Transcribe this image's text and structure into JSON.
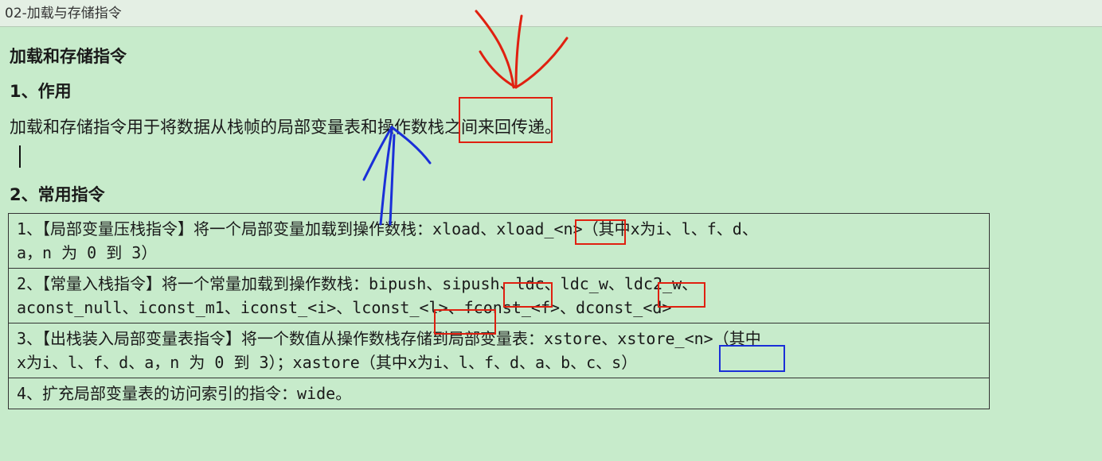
{
  "window": {
    "title": "02-加载与存储指令"
  },
  "doc": {
    "heading": "加载和存储指令",
    "section1_title": "1、作用",
    "section1_body": "加载和存储指令用于将数据从栈帧的局部变量表和操作数栈之间来回传递。",
    "section2_title": "2、常用指令",
    "rows": [
      {
        "line1": "1、【局部变量压栈指令】将一个局部变量加载到操作数栈：xload、xload_<n>（其中x为i、l、f、d、",
        "line2": "a，n 为 0 到 3）"
      },
      {
        "line1": "2、【常量入栈指令】将一个常量加载到操作数栈：bipush、sipush、ldc、ldc_w、ldc2_w、",
        "line2": "aconst_null、iconst_m1、iconst_<i>、lconst_<l>、fconst_<f>、dconst_<d>"
      },
      {
        "line1": "3、【出栈装入局部变量表指令】将一个数值从操作数栈存储到局部变量表：xstore、xstore_<n>（其中",
        "line2": "x为i、l、f、d、a，n 为 0 到 3）；xastore（其中x为i、l、f、d、a、b、c、s）"
      },
      {
        "line1": "4、扩充局部变量表的访问索引的指令：wide。",
        "line2": ""
      }
    ]
  },
  "annotations": {
    "red_color": "#e02010",
    "blue_color": "#1a2fd8",
    "red_arrow_icon": "hand-drawn-down-arrow",
    "blue_arrow_icon": "hand-drawn-up-arrow"
  }
}
